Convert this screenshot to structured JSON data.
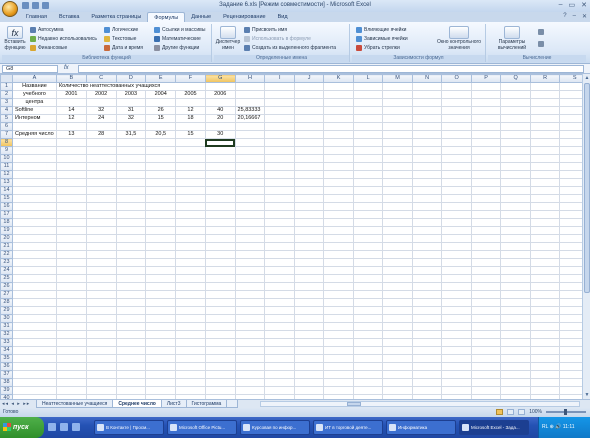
{
  "window": {
    "title": "Задание 6.xls [Режим совместимости] - Microsoft Excel",
    "controls": [
      "–",
      "▭",
      "✕"
    ]
  },
  "ribbon": {
    "tabs": [
      "Главная",
      "Вставка",
      "Разметка страницы",
      "Формулы",
      "Данные",
      "Рецензирование",
      "Вид"
    ],
    "active_tab": "Формулы",
    "groups": {
      "library": {
        "label": "Библиотека функций",
        "insert_function": "Вставить функцию",
        "autosum": "Автосумма",
        "recently_used": "Недавно использовались",
        "financial": "Финансовые",
        "logical": "Логические",
        "text": "Текстовые",
        "date_time": "Дата и время",
        "lookup": "Ссылки и массивы",
        "math": "Математические",
        "more": "Другие функции"
      },
      "names": {
        "label": "Определенные имена",
        "name_manager": "Диспетчер имен",
        "define_name": "Присвоить имя",
        "use_in_formula": "Использовать в формуле",
        "create_from_selection": "Создать из выделенного фрагмента"
      },
      "audit": {
        "label": "Зависимости формул",
        "trace_precedents": "Влияющие ячейки",
        "trace_dependents": "Зависимые ячейки",
        "remove_arrows": "Убрать стрелки",
        "watch_window": "Окно контрольного значения"
      },
      "calc": {
        "label": "Вычисление",
        "options": "Параметры вычислений"
      }
    }
  },
  "formula_bar": {
    "name_box": "G8",
    "fx_label": "fx",
    "value": ""
  },
  "sheet": {
    "columns": [
      "A",
      "B",
      "C",
      "D",
      "E",
      "F",
      "G",
      "H",
      "I",
      "J",
      "K",
      "L",
      "M",
      "N",
      "O",
      "P",
      "Q",
      "R",
      "S"
    ],
    "selected_column": "G",
    "selected_row": 8,
    "header_title": "Количество неаттестованных учащихся",
    "row1_a": "Название",
    "row2_a": "учебного",
    "row3_a": "центра",
    "years": [
      "2001",
      "2002",
      "2003",
      "2004",
      "2005",
      "2006"
    ],
    "rows": [
      {
        "name": "Softline",
        "values": [
          "14",
          "32",
          "31",
          "26",
          "12",
          "40"
        ],
        "extra": "25,83333"
      },
      {
        "name": "Интерном",
        "values": [
          "12",
          "24",
          "32",
          "15",
          "18",
          "20"
        ],
        "extra": "20,16667"
      }
    ],
    "avg_label": "Средняя число",
    "avg_values": [
      "13",
      "28",
      "31,5",
      "20,5",
      "15",
      "30"
    ],
    "row_count": 40
  },
  "sheet_tabs": {
    "nav": "◂◂ ◂ ▸ ▸▸",
    "tabs": [
      "Неаттестованные учащиеся",
      "Среднее число",
      "Лист3",
      "Гистограмма"
    ],
    "active": "Среднее число"
  },
  "status": {
    "ready": "Готово",
    "zoom": "100%"
  },
  "taskbar": {
    "start": "пуск",
    "tasks": [
      "В Контакте | Просм...",
      "Microsoft Office Pictu...",
      "Курсовая по инфор...",
      "ИТ в торговой деяте...",
      "Информатика",
      "Microsoft Excel - Зада..."
    ],
    "active_task": "Microsoft Excel - Зада...",
    "tray_text": "RL ⊕ 🔊 11:11"
  }
}
